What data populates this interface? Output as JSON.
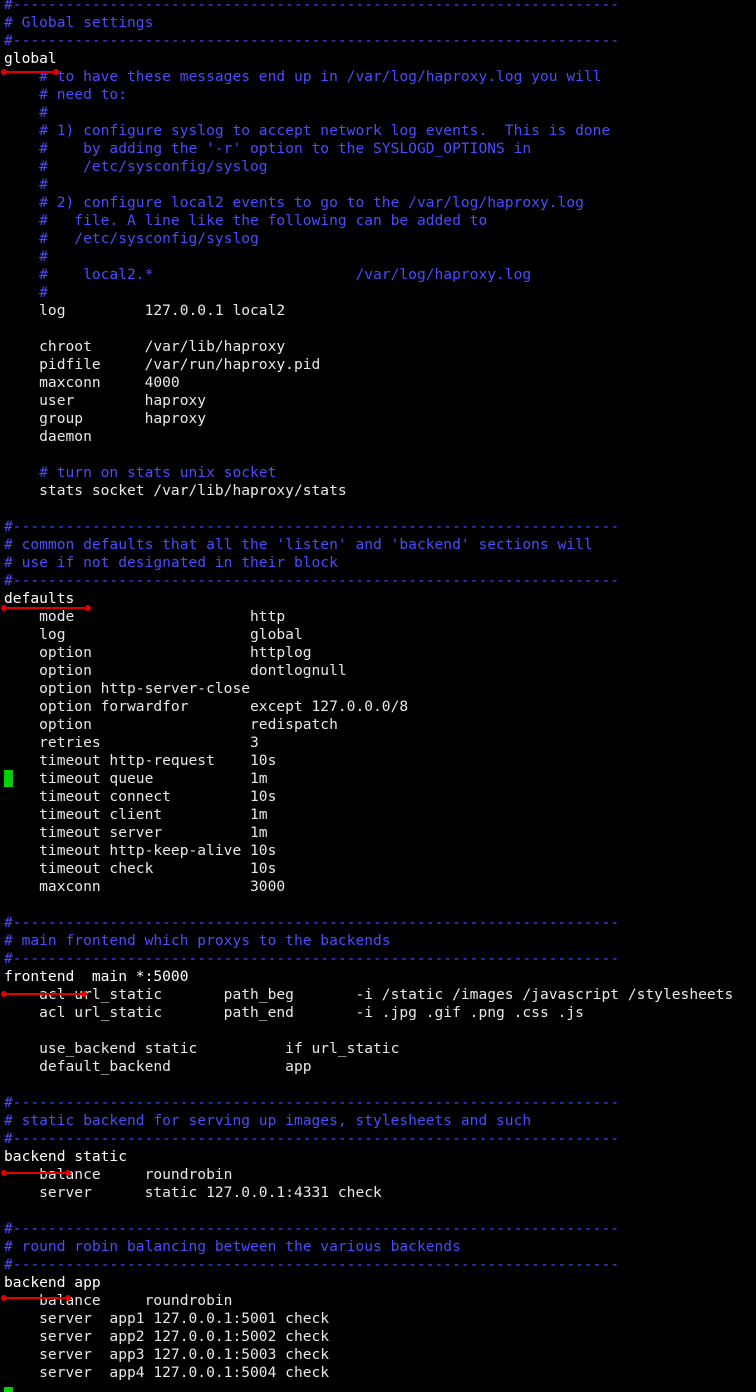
{
  "terminal": {
    "colors": {
      "background": "#000000",
      "text": "#e8e8e8",
      "comment": "#4b4bff",
      "cursor": "#00d000",
      "annotation": "#e00000"
    },
    "lines": [
      {
        "t": "#---------------------------------------------------------------------",
        "k": "c"
      },
      {
        "t": "# Global settings",
        "k": "c"
      },
      {
        "t": "#---------------------------------------------------------------------",
        "k": "c"
      },
      {
        "t": "global",
        "k": "b"
      },
      {
        "t": "    # to have these messages end up in /var/log/haproxy.log you will",
        "k": "c"
      },
      {
        "t": "    # need to:",
        "k": "c"
      },
      {
        "t": "    #",
        "k": "c"
      },
      {
        "t": "    # 1) configure syslog to accept network log events.  This is done",
        "k": "c"
      },
      {
        "t": "    #    by adding the '-r' option to the SYSLOGD_OPTIONS in",
        "k": "c"
      },
      {
        "t": "    #    /etc/sysconfig/syslog",
        "k": "c"
      },
      {
        "t": "    #",
        "k": "c"
      },
      {
        "t": "    # 2) configure local2 events to go to the /var/log/haproxy.log",
        "k": "c"
      },
      {
        "t": "    #   file. A line like the following can be added to",
        "k": "c"
      },
      {
        "t": "    #   /etc/sysconfig/syslog",
        "k": "c"
      },
      {
        "t": "    #",
        "k": "c"
      },
      {
        "t": "    #    local2.*                       /var/log/haproxy.log",
        "k": "c"
      },
      {
        "t": "    #",
        "k": "c"
      },
      {
        "t": "    log         127.0.0.1 local2",
        "k": "w"
      },
      {
        "t": "",
        "k": "w"
      },
      {
        "t": "    chroot      /var/lib/haproxy",
        "k": "w"
      },
      {
        "t": "    pidfile     /var/run/haproxy.pid",
        "k": "w"
      },
      {
        "t": "    maxconn     4000",
        "k": "w"
      },
      {
        "t": "    user        haproxy",
        "k": "w"
      },
      {
        "t": "    group       haproxy",
        "k": "w"
      },
      {
        "t": "    daemon",
        "k": "w"
      },
      {
        "t": "",
        "k": "w"
      },
      {
        "t": "    # turn on stats unix socket",
        "k": "c"
      },
      {
        "t": "    stats socket /var/lib/haproxy/stats",
        "k": "w"
      },
      {
        "t": "",
        "k": "w"
      },
      {
        "t": "#---------------------------------------------------------------------",
        "k": "c"
      },
      {
        "t": "# common defaults that all the 'listen' and 'backend' sections will",
        "k": "c"
      },
      {
        "t": "# use if not designated in their block",
        "k": "c"
      },
      {
        "t": "#---------------------------------------------------------------------",
        "k": "c"
      },
      {
        "t": "defaults",
        "k": "b"
      },
      {
        "t": "    mode                    http",
        "k": "w"
      },
      {
        "t": "    log                     global",
        "k": "w"
      },
      {
        "t": "    option                  httplog",
        "k": "w"
      },
      {
        "t": "    option                  dontlognull",
        "k": "w"
      },
      {
        "t": "    option http-server-close",
        "k": "w"
      },
      {
        "t": "    option forwardfor       except 127.0.0.0/8",
        "k": "w"
      },
      {
        "t": "    option                  redispatch",
        "k": "w"
      },
      {
        "t": "    retries                 3",
        "k": "w"
      },
      {
        "t": "    timeout http-request    10s",
        "k": "w"
      },
      {
        "t": "    timeout queue           1m",
        "k": "w"
      },
      {
        "t": "    timeout connect         10s",
        "k": "w"
      },
      {
        "t": "    timeout client          1m",
        "k": "w"
      },
      {
        "t": "    timeout server          1m",
        "k": "w"
      },
      {
        "t": "    timeout http-keep-alive 10s",
        "k": "w"
      },
      {
        "t": "    timeout check           10s",
        "k": "w"
      },
      {
        "t": "    maxconn                 3000",
        "k": "w"
      },
      {
        "t": "",
        "k": "w"
      },
      {
        "t": "#---------------------------------------------------------------------",
        "k": "c"
      },
      {
        "t": "# main frontend which proxys to the backends",
        "k": "c"
      },
      {
        "t": "#---------------------------------------------------------------------",
        "k": "c"
      },
      {
        "t": "frontend  main *:5000",
        "k": "b"
      },
      {
        "t": "    acl url_static       path_beg       -i /static /images /javascript /stylesheets",
        "k": "w"
      },
      {
        "t": "    acl url_static       path_end       -i .jpg .gif .png .css .js",
        "k": "w"
      },
      {
        "t": "",
        "k": "w"
      },
      {
        "t": "    use_backend static          if url_static",
        "k": "w"
      },
      {
        "t": "    default_backend             app",
        "k": "w"
      },
      {
        "t": "",
        "k": "w"
      },
      {
        "t": "#---------------------------------------------------------------------",
        "k": "c"
      },
      {
        "t": "# static backend for serving up images, stylesheets and such",
        "k": "c"
      },
      {
        "t": "#---------------------------------------------------------------------",
        "k": "c"
      },
      {
        "t": "backend static",
        "k": "b"
      },
      {
        "t": "    balance     roundrobin",
        "k": "w"
      },
      {
        "t": "    server      static 127.0.0.1:4331 check",
        "k": "w"
      },
      {
        "t": "",
        "k": "w"
      },
      {
        "t": "#---------------------------------------------------------------------",
        "k": "c"
      },
      {
        "t": "# round robin balancing between the various backends",
        "k": "c"
      },
      {
        "t": "#---------------------------------------------------------------------",
        "k": "c"
      },
      {
        "t": "backend app",
        "k": "b"
      },
      {
        "t": "    balance     roundrobin",
        "k": "w"
      },
      {
        "t": "    server  app1 127.0.0.1:5001 check",
        "k": "w"
      },
      {
        "t": "    server  app2 127.0.0.1:5002 check",
        "k": "w"
      },
      {
        "t": "    server  app3 127.0.0.1:5003 check",
        "k": "w"
      },
      {
        "t": "    server  app4 127.0.0.1:5004 check",
        "k": "w"
      }
    ]
  }
}
